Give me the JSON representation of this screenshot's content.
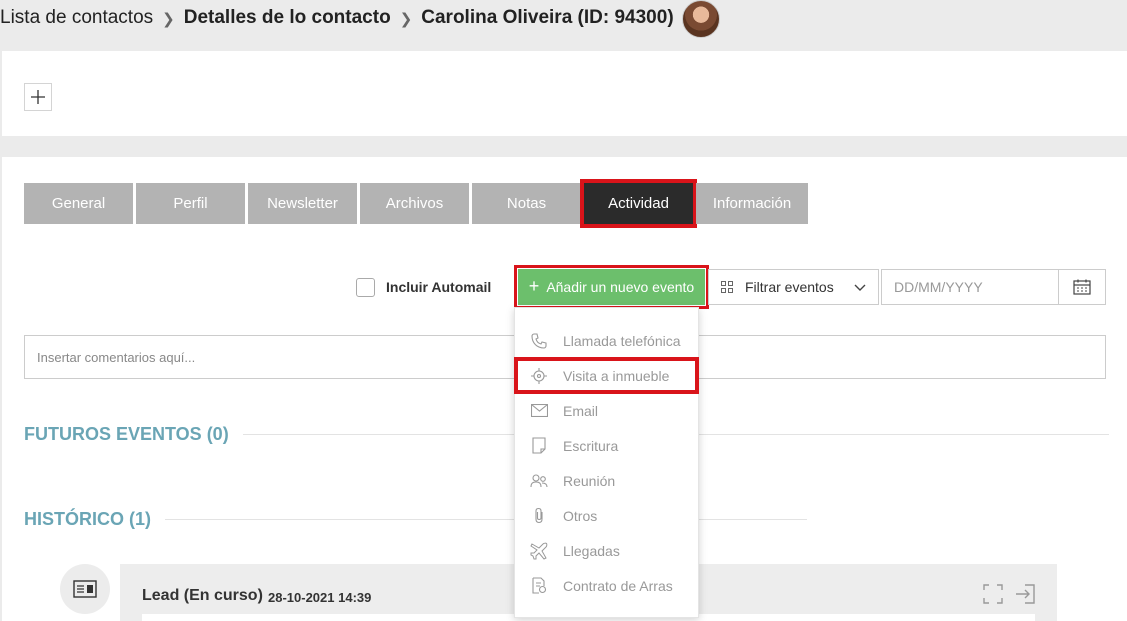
{
  "breadcrumb": {
    "items": [
      "Lista de contactos",
      "Detalles de lo contacto",
      "Carolina Oliveira (ID: 94300)"
    ]
  },
  "tabs": [
    {
      "label": "General",
      "active": false
    },
    {
      "label": "Perfil",
      "active": false
    },
    {
      "label": "Newsletter",
      "active": false
    },
    {
      "label": "Archivos",
      "active": false
    },
    {
      "label": "Notas",
      "active": false
    },
    {
      "label": "Actividad",
      "active": true
    },
    {
      "label": "Información",
      "active": false
    }
  ],
  "toolbar": {
    "include_automail_label": "Incluir Automail",
    "add_event_label": "Añadir un nuevo evento",
    "filter_label": "Filtrar eventos",
    "date_placeholder": "DD/MM/YYYY"
  },
  "comment": {
    "placeholder": "Insertar comentarios aquí..."
  },
  "sections": {
    "future": "FUTUROS EVENTOS (0)",
    "history": "HISTÓRICO (1)"
  },
  "history_item": {
    "title": "Lead (En curso)",
    "date": "28-10-2021 14:39"
  },
  "dropdown": {
    "items": [
      {
        "label": "Llamada telefónica",
        "icon": "phone-icon"
      },
      {
        "label": "Visita a inmueble",
        "icon": "target-icon",
        "highlighted": true
      },
      {
        "label": "Email",
        "icon": "envelope-icon"
      },
      {
        "label": "Escritura",
        "icon": "document-icon"
      },
      {
        "label": "Reunión",
        "icon": "people-icon"
      },
      {
        "label": "Otros",
        "icon": "paperclip-icon"
      },
      {
        "label": "Llegadas",
        "icon": "plane-icon"
      },
      {
        "label": "Contrato de Arras",
        "icon": "contract-icon"
      }
    ]
  },
  "colors": {
    "accent_green": "#6cbf6c",
    "highlight_red": "#d9141a",
    "tab_active": "#2b2b2b",
    "tab_inactive": "#b3b3b3",
    "section_title": "#6aa5b5"
  }
}
